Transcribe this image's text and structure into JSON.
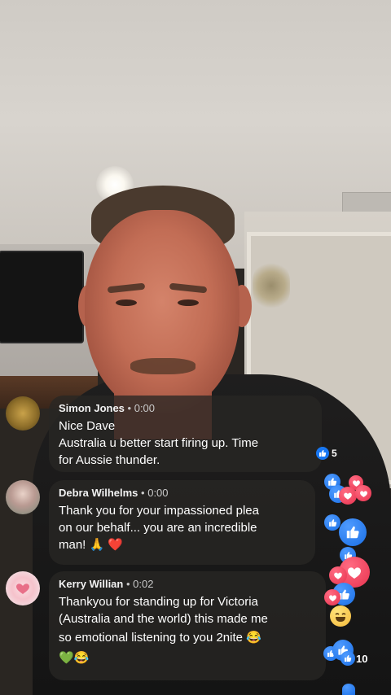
{
  "comments": [
    {
      "name": "Simon Jones",
      "time": "0:00",
      "lines": [
        "Nice Dave",
        "Australia u better start firing up. Time",
        "for Aussie thunder."
      ],
      "reaction_count": "5"
    },
    {
      "name": "Debra Wilhelms",
      "time": "0:00",
      "lines": [
        "Thank you for your impassioned plea",
        "on our behalf... you are an incredible",
        "man! 🙏 ❤️"
      ]
    },
    {
      "name": "Kerry Willian",
      "time": "0:02",
      "lines": [
        "Thankyou for standing up for Victoria",
        "(Australia and the world) this made me",
        "so emotional listening to you 2nite 😂",
        "💚😂"
      ]
    }
  ],
  "reactions": {
    "total_count": "10",
    "types": [
      "like",
      "love",
      "haha"
    ]
  },
  "icons": {
    "like": "thumbs-up-icon",
    "love": "heart-icon",
    "haha": "laugh-icon"
  },
  "colors": {
    "like_blue": "#1877f2",
    "love_red": "#e8334f",
    "haha_yellow": "#f5b93a",
    "bubble_bg": "#282624"
  }
}
